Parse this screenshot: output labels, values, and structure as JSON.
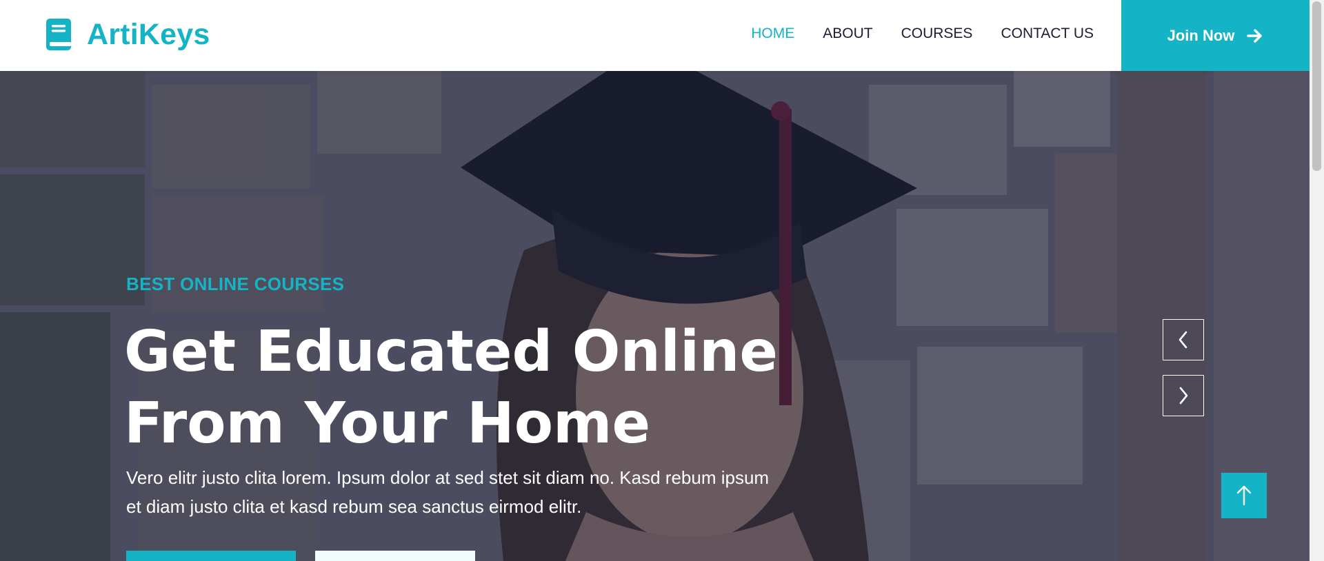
{
  "brand": {
    "name": "ArtiKeys",
    "icon": "book-icon",
    "color": "#15b3c6"
  },
  "nav": {
    "items": [
      {
        "label": "HOME",
        "active": true
      },
      {
        "label": "ABOUT",
        "active": false
      },
      {
        "label": "COURSES",
        "active": false
      },
      {
        "label": "CONTACT US",
        "active": false
      }
    ],
    "join_label": "Join Now",
    "join_icon": "arrow-right-icon"
  },
  "hero": {
    "eyebrow": "BEST ONLINE COURSES",
    "headline_line1": "Get Educated Online",
    "headline_line2": "From Your Home",
    "lead_line1": "Vero elitr justo clita lorem. Ipsum dolor at sed stet sit diam no. Kasd rebum ipsum",
    "lead_line2": "et diam justo clita et kasd rebum sea sanctus eirmod elitr.",
    "image": "graduate-portrait-background",
    "overlay_color": "#181d38"
  },
  "slider": {
    "prev_icon": "chevron-left-icon",
    "next_icon": "chevron-right-icon"
  },
  "back_to_top_icon": "arrow-up-icon",
  "colors": {
    "accent": "#15b3c6",
    "dark": "#181d38",
    "text": "#181d38"
  }
}
